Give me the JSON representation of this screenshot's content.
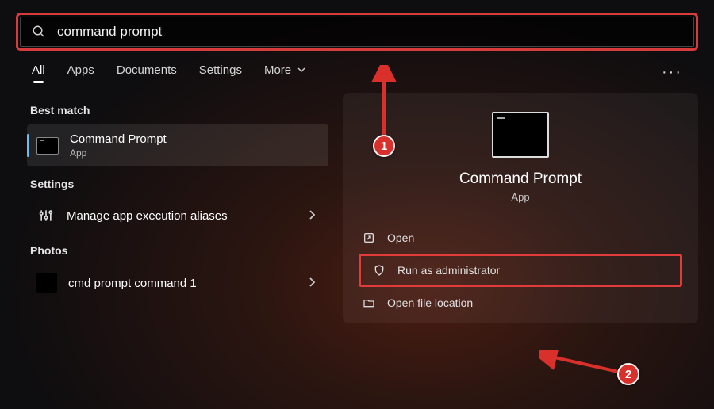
{
  "search": {
    "value": "command prompt"
  },
  "tabs": {
    "items": [
      "All",
      "Apps",
      "Documents",
      "Settings",
      "More"
    ],
    "active_index": 0
  },
  "annotations": {
    "badge1": "1",
    "badge2": "2"
  },
  "left": {
    "best_match_header": "Best match",
    "best_match": {
      "title": "Command Prompt",
      "subtitle": "App"
    },
    "settings_header": "Settings",
    "settings_item": "Manage app execution aliases",
    "photos_header": "Photos",
    "photos_item": "cmd prompt command 1"
  },
  "right": {
    "app_name": "Command Prompt",
    "app_type": "App",
    "actions": {
      "open": "Open",
      "run_admin": "Run as administrator",
      "open_location": "Open file location"
    }
  }
}
